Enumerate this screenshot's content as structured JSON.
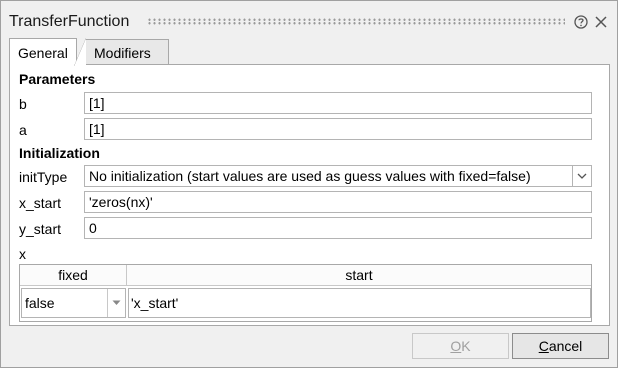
{
  "window": {
    "title": "TransferFunction"
  },
  "tabs": [
    {
      "label": "General",
      "active": true
    },
    {
      "label": "Modifiers",
      "active": false
    }
  ],
  "parameters": {
    "header": "Parameters",
    "b": {
      "label": "b",
      "value": "[1]"
    },
    "a": {
      "label": "a",
      "value": "[1]"
    }
  },
  "initialization": {
    "header": "Initialization",
    "initType": {
      "label": "initType",
      "value": "No initialization (start values are used as guess values with fixed=false)"
    },
    "x_start": {
      "label": "x_start",
      "value": "'zeros(nx)'"
    },
    "y_start": {
      "label": "y_start",
      "value": "0"
    },
    "x": {
      "label": "x",
      "columns": [
        "fixed",
        "start"
      ],
      "rows": [
        {
          "fixed": "false",
          "start": "'x_start'"
        }
      ]
    }
  },
  "buttons": {
    "ok": {
      "label": "OK",
      "enabled": false
    },
    "cancel": {
      "label": "Cancel",
      "enabled": true
    }
  },
  "icons": {
    "help": "help-icon",
    "close": "close-icon",
    "dropdown": "chevron-down-icon"
  },
  "colors": {
    "window_bg": "#f0f0f0",
    "panel_bg": "#ffffff",
    "border": "#a8a8a8",
    "disabled_text": "#a0a0a0"
  }
}
